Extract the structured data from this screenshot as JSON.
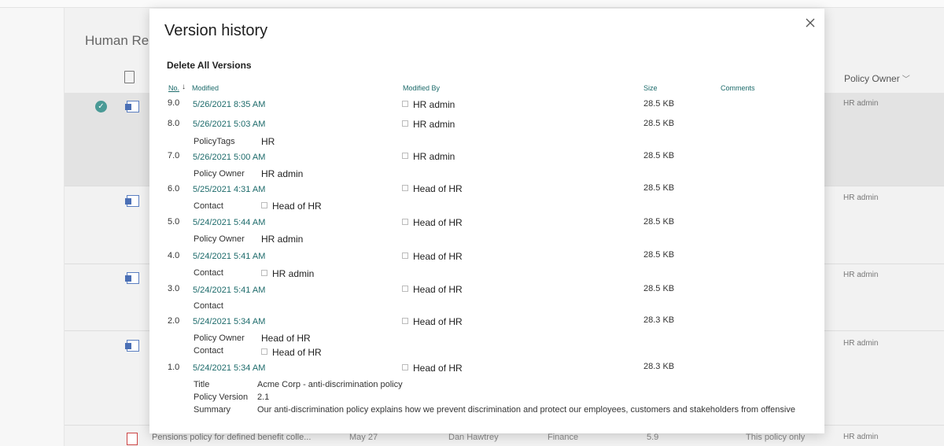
{
  "background": {
    "page_title": "Human Re",
    "column_header": "Policy Owner",
    "owner_values": [
      "HR admin",
      "HR admin",
      "HR admin",
      "HR admin",
      "HR admin"
    ],
    "bottom_row": {
      "name": "Pensions policy for defined benefit colle...",
      "modified": "May 27",
      "modified_by": "Dan Hawtrey",
      "department": "Finance",
      "version": "5.9",
      "description": "This policy only"
    }
  },
  "dialog": {
    "title": "Version history",
    "delete_all_label": "Delete All Versions",
    "headers": {
      "no": "No.",
      "modified": "Modified",
      "modified_by": "Modified By",
      "size": "Size",
      "comments": "Comments"
    },
    "versions": [
      {
        "no": "9.0",
        "modified": "5/26/2021 8:35 AM",
        "modified_by": "HR admin",
        "size": "28.5 KB"
      },
      {
        "no": "8.0",
        "modified": "5/26/2021 5:03 AM",
        "modified_by": "HR admin",
        "size": "28.5 KB",
        "props": [
          {
            "label": "PolicyTags",
            "value": "HR"
          }
        ]
      },
      {
        "no": "7.0",
        "modified": "5/26/2021 5:00 AM",
        "modified_by": "HR admin",
        "size": "28.5 KB",
        "props": [
          {
            "label": "Policy Owner",
            "value": "HR admin"
          }
        ]
      },
      {
        "no": "6.0",
        "modified": "5/25/2021 4:31 AM",
        "modified_by": "Head of HR",
        "size": "28.5 KB",
        "props": [
          {
            "label": "Contact",
            "value": "Head of HR"
          }
        ]
      },
      {
        "no": "5.0",
        "modified": "5/24/2021 5:44 AM",
        "modified_by": "Head of HR",
        "size": "28.5 KB",
        "props": [
          {
            "label": "Policy Owner",
            "value": "HR admin"
          }
        ]
      },
      {
        "no": "4.0",
        "modified": "5/24/2021 5:41 AM",
        "modified_by": "Head of HR",
        "size": "28.5 KB",
        "props": [
          {
            "label": "Contact",
            "value": "HR admin"
          }
        ]
      },
      {
        "no": "3.0",
        "modified": "5/24/2021 5:41 AM",
        "modified_by": "Head of HR",
        "size": "28.5 KB",
        "props": [
          {
            "label": "Contact",
            "value": ""
          }
        ]
      },
      {
        "no": "2.0",
        "modified": "5/24/2021 5:34 AM",
        "modified_by": "Head of HR",
        "size": "28.3 KB",
        "props": [
          {
            "label": "Policy Owner",
            "value": "Head of HR"
          },
          {
            "label": "Contact",
            "value": "Head of HR"
          }
        ]
      },
      {
        "no": "1.0",
        "modified": "5/24/2021 5:34 AM",
        "modified_by": "Head of HR",
        "size": "28.3 KB",
        "props": [
          {
            "label": "Title",
            "value": "Acme Corp - anti-discrimination policy"
          },
          {
            "label": "Policy Version",
            "value": "2.1"
          },
          {
            "label": "Summary",
            "value": "Our anti-discrimination policy explains how we prevent discrimination and protect our employees, customers and stakeholders from offensive"
          }
        ]
      }
    ]
  },
  "icons": {
    "close": "close-icon",
    "sort": "sort-down-icon",
    "person": "person-icon",
    "document": "word-document-icon"
  },
  "colors": {
    "link": "#1d6b6b",
    "check": "#4a9a96"
  }
}
